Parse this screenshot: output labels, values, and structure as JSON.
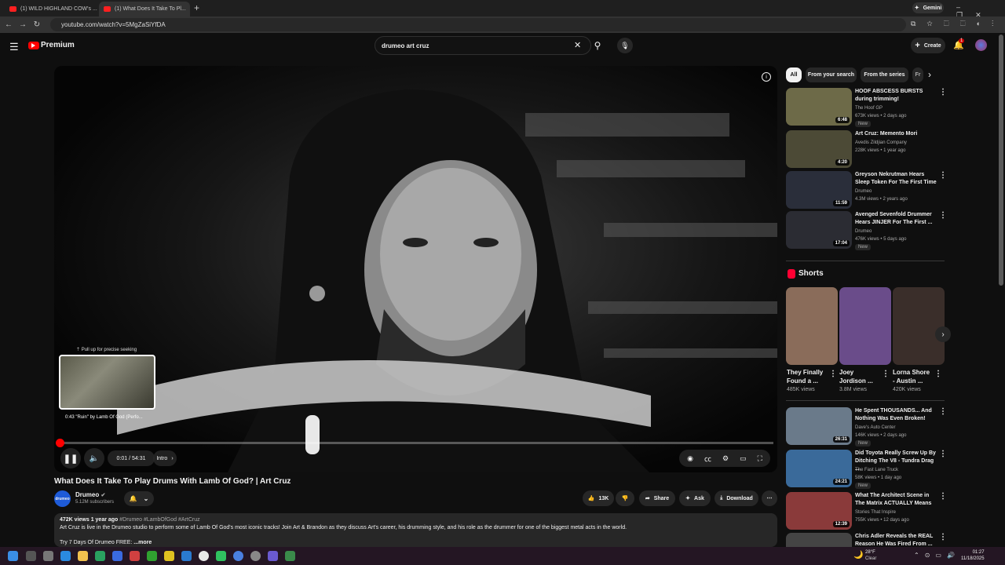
{
  "browser": {
    "tabs": [
      {
        "label": "(1) WILD HIGHLAND COW's ..."
      },
      {
        "label": "(1) What Does It Take To Pl..."
      }
    ],
    "url": "youtube.com/watch?v=5MgZaSiYfDA",
    "gemini_label": "Gemini"
  },
  "header": {
    "logo_text": "Premium",
    "search_value": "drumeo art cruz",
    "create_label": "Create",
    "notification_count": "1"
  },
  "player": {
    "hover_hint": "Pull up for precise seeking",
    "preview_time": "0:43",
    "preview_label": "\"Ruin\" by Lamb Of God (Perfo...",
    "time_display": "0:01 / 54:31",
    "chapter": "Intro",
    "progress_fraction": 0.001
  },
  "video": {
    "title": "What Does It Take To Play Drums With Lamb Of God? | Art Cruz",
    "channel": "Drumeo",
    "subscribers": "5.12M subscribers",
    "likes": "13K",
    "share_label": "Share",
    "ask_label": "Ask",
    "download_label": "Download",
    "views_date": "472K views  1 year ago",
    "hashtags": "#Drumeo #LambOfGod #ArtCruz",
    "description": "Art Cruz is live in the Drumeo studio to perform some of Lamb Of God's most iconic tracks! Join Art & Brandon as they discuss Art's career, his drumming style, and his role as the drummer for one of the biggest metal acts in the world.",
    "desc_line2": "Try 7 Days Of Drumeo FREE:",
    "more_label": "...more"
  },
  "filters": [
    "All",
    "From your search",
    "From the series",
    "Fr"
  ],
  "recommended": [
    {
      "title": "HOOF ABSCESS BURSTS during trimming!",
      "channel": "The Hoof GP",
      "meta": "673K views • 2 days ago",
      "duration": "6:48",
      "badge": "New",
      "color": "#6d6a48"
    },
    {
      "title": "Art Cruz: Memento Mori",
      "channel": "Avedis Zildjian Company",
      "meta": "228K views • 1 year ago",
      "duration": "4:20",
      "badge": "",
      "color": "#4c4a36"
    },
    {
      "title": "Greyson Nekrutman Hears Sleep Token For The First Time",
      "channel": "Drumeo",
      "meta": "4.3M views • 2 years ago",
      "duration": "11:59",
      "badge": "",
      "color": "#2a2e3a"
    },
    {
      "title": "Avenged Sevenfold Drummer Hears JINJER For The First ...",
      "channel": "Drumeo",
      "meta": "476K views • 5 days ago",
      "duration": "17:04",
      "badge": "New",
      "color": "#2b2c33"
    }
  ],
  "shorts": {
    "heading": "Shorts",
    "items": [
      {
        "title": "They Finally Found a ...",
        "views": "485K views",
        "color": "#8a6c5a"
      },
      {
        "title": "Joey Jordison ...",
        "views": "3.8M views",
        "color": "#6a4c8a"
      },
      {
        "title": "Lorna Shore - Austin ...",
        "views": "420K views",
        "color": "#3a2e2a"
      }
    ]
  },
  "recommended2": [
    {
      "title": "He Spent THOUSANDS... And Nothing Was Even Broken!",
      "channel": "Dave's Auto Center",
      "meta": "146K views • 2 days ago",
      "duration": "26:31",
      "badge": "New",
      "color": "#6a7a8a"
    },
    {
      "title": "Did Toyota Really Screw Up By Ditching The V8 - Tundra Drag ...",
      "channel": "The Fast Lane Truck",
      "meta": "58K views • 1 day ago",
      "duration": "24:21",
      "badge": "New",
      "color": "#3a6a9a"
    },
    {
      "title": "What The Architect Scene in The Matrix ACTUALLY Means",
      "channel": "Stories That Inspire",
      "meta": "755K views • 12 days ago",
      "duration": "12:39",
      "badge": "",
      "color": "#8a3a3a"
    },
    {
      "title": "Chris Adler Reveals the REAL Reason He Was Fired From ...",
      "channel": "",
      "meta": "",
      "duration": "",
      "badge": "",
      "color": "#444"
    }
  ],
  "taskbar": {
    "weather_temp": "28°F",
    "weather_desc": "Clear",
    "time": "01:27",
    "date": "11/18/2025"
  }
}
